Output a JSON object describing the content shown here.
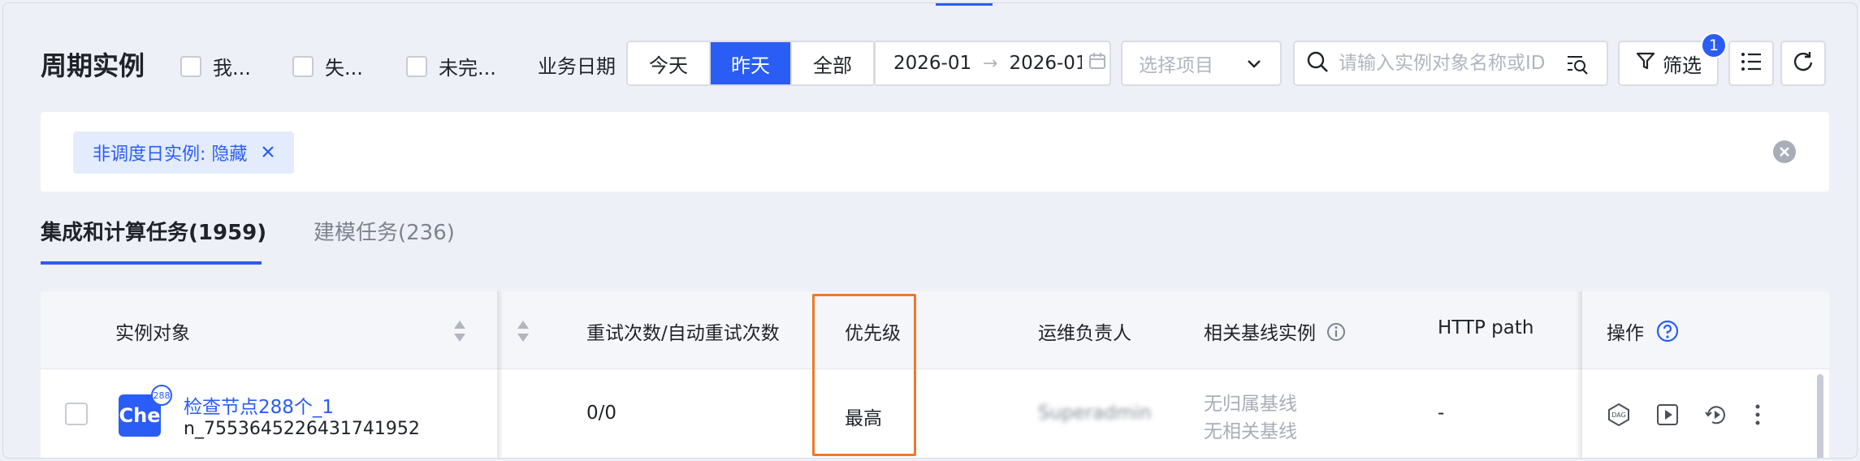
{
  "page": {
    "title": "周期实例"
  },
  "filters": {
    "checkboxes": [
      {
        "label": "我..."
      },
      {
        "label": "失..."
      },
      {
        "label": "未完..."
      }
    ],
    "biz_date_label": "业务日期",
    "date_segments": [
      {
        "label": "今天",
        "active": false
      },
      {
        "label": "昨天",
        "active": true
      },
      {
        "label": "全部",
        "active": false
      }
    ],
    "date_range": {
      "start": "2026-01",
      "end": "2026-01"
    },
    "project_select": {
      "placeholder": "选择项目"
    },
    "search": {
      "placeholder": "请输入实例对象名称或ID"
    },
    "filter_button": {
      "label": "筛选",
      "badge": "1"
    }
  },
  "tag_bar": {
    "tag": "非调度日实例: 隐藏"
  },
  "tabs": [
    {
      "label": "集成和计算任务(1959)",
      "active": true
    },
    {
      "label": "建模任务(236)",
      "active": false
    }
  ],
  "table": {
    "headers": {
      "instance": "实例对象",
      "retry": "重试次数/自动重试次数",
      "priority": "优先级",
      "owner": "运维负责人",
      "baseline": "相关基线实例",
      "http_path": "HTTP path",
      "ops": "操作"
    },
    "rows": [
      {
        "icon_text": "Che",
        "icon_badge": "288",
        "name": "检查节点288个_1",
        "id": "n_7553645226431741952",
        "retry": "0/0",
        "priority": "最高",
        "owner": "Superadmin",
        "baseline_1": "无归属基线",
        "baseline_2": "无相关基线",
        "http_path": "-"
      }
    ]
  },
  "colors": {
    "accent": "#2a5cf6",
    "highlight": "#f0782a"
  }
}
